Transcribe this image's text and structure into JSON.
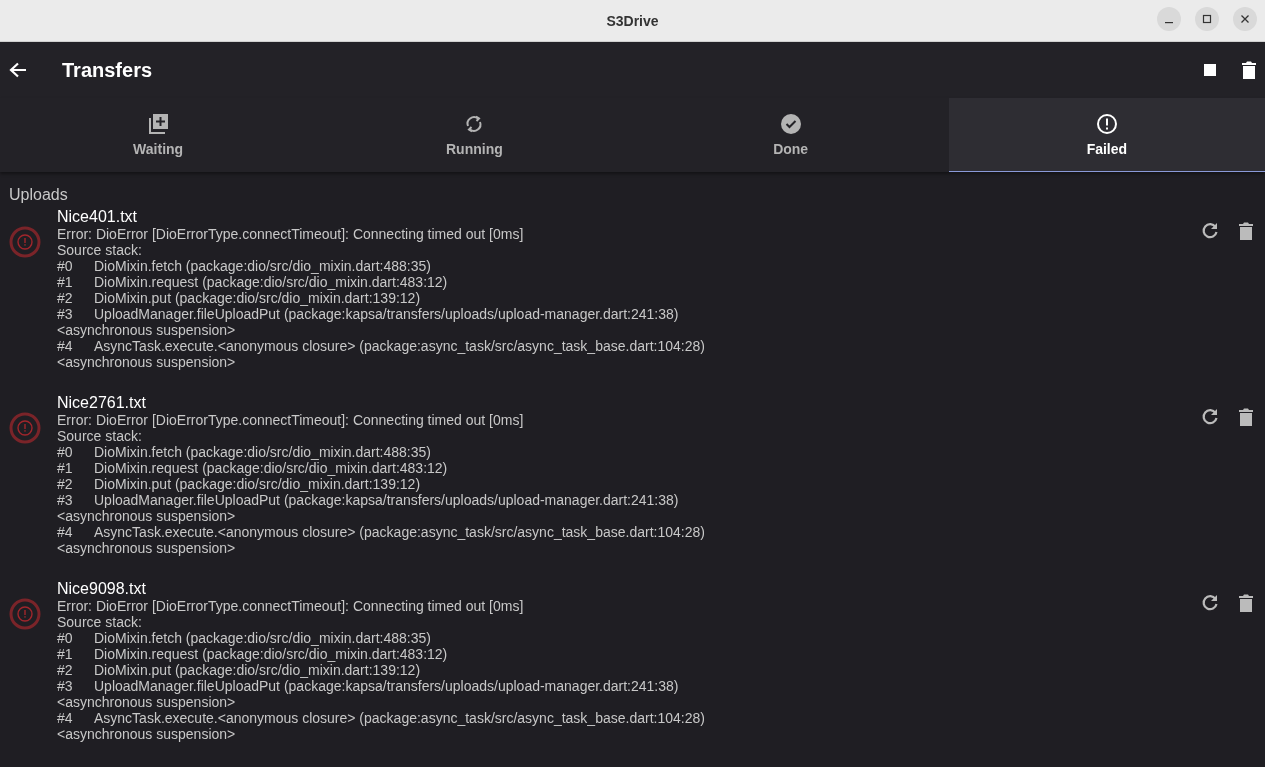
{
  "window": {
    "title": "S3Drive"
  },
  "app_bar": {
    "title": "Transfers"
  },
  "tabs": [
    {
      "label": "Waiting",
      "kind": "queue",
      "selected": false
    },
    {
      "label": "Running",
      "kind": "sync",
      "selected": false
    },
    {
      "label": "Done",
      "kind": "check",
      "selected": false
    },
    {
      "label": "Failed",
      "kind": "error",
      "selected": true
    }
  ],
  "section": "Uploads",
  "items": [
    {
      "name": "Nice401.txt",
      "error": "Error: DioError [DioErrorType.connectTimeout]: Connecting timed out [0ms]",
      "stack_header": "Source stack:",
      "stack": [
        {
          "kind": "frame",
          "index": "#0",
          "call": "DioMixin.fetch (package:dio/src/dio_mixin.dart:488:35)"
        },
        {
          "kind": "frame",
          "index": "#1",
          "call": "DioMixin.request (package:dio/src/dio_mixin.dart:483:12)"
        },
        {
          "kind": "frame",
          "index": "#2",
          "call": "DioMixin.put (package:dio/src/dio_mixin.dart:139:12)"
        },
        {
          "kind": "frame",
          "index": "#3",
          "call": "UploadManager.fileUploadPut (package:kapsa/transfers/uploads/upload-manager.dart:241:38)"
        },
        {
          "kind": "note",
          "text": "<asynchronous suspension>"
        },
        {
          "kind": "frame",
          "index": "#4",
          "call": "AsyncTask.execute.<anonymous closure> (package:async_task/src/async_task_base.dart:104:28)"
        },
        {
          "kind": "note",
          "text": "<asynchronous suspension>"
        }
      ]
    },
    {
      "name": "Nice2761.txt",
      "error": "Error: DioError [DioErrorType.connectTimeout]: Connecting timed out [0ms]",
      "stack_header": "Source stack:",
      "stack": [
        {
          "kind": "frame",
          "index": "#0",
          "call": "DioMixin.fetch (package:dio/src/dio_mixin.dart:488:35)"
        },
        {
          "kind": "frame",
          "index": "#1",
          "call": "DioMixin.request (package:dio/src/dio_mixin.dart:483:12)"
        },
        {
          "kind": "frame",
          "index": "#2",
          "call": "DioMixin.put (package:dio/src/dio_mixin.dart:139:12)"
        },
        {
          "kind": "frame",
          "index": "#3",
          "call": "UploadManager.fileUploadPut (package:kapsa/transfers/uploads/upload-manager.dart:241:38)"
        },
        {
          "kind": "note",
          "text": "<asynchronous suspension>"
        },
        {
          "kind": "frame",
          "index": "#4",
          "call": "AsyncTask.execute.<anonymous closure> (package:async_task/src/async_task_base.dart:104:28)"
        },
        {
          "kind": "note",
          "text": "<asynchronous suspension>"
        }
      ]
    },
    {
      "name": "Nice9098.txt",
      "error": "Error: DioError [DioErrorType.connectTimeout]: Connecting timed out [0ms]",
      "stack_header": "Source stack:",
      "stack": [
        {
          "kind": "frame",
          "index": "#0",
          "call": "DioMixin.fetch (package:dio/src/dio_mixin.dart:488:35)"
        },
        {
          "kind": "frame",
          "index": "#1",
          "call": "DioMixin.request (package:dio/src/dio_mixin.dart:483:12)"
        },
        {
          "kind": "frame",
          "index": "#2",
          "call": "DioMixin.put (package:dio/src/dio_mixin.dart:139:12)"
        },
        {
          "kind": "frame",
          "index": "#3",
          "call": "UploadManager.fileUploadPut (package:kapsa/transfers/uploads/upload-manager.dart:241:38)"
        },
        {
          "kind": "note",
          "text": "<asynchronous suspension>"
        },
        {
          "kind": "frame",
          "index": "#4",
          "call": "AsyncTask.execute.<anonymous closure> (package:async_task/src/async_task_base.dart:104:28)"
        },
        {
          "kind": "note",
          "text": "<asynchronous suspension>"
        }
      ]
    }
  ]
}
